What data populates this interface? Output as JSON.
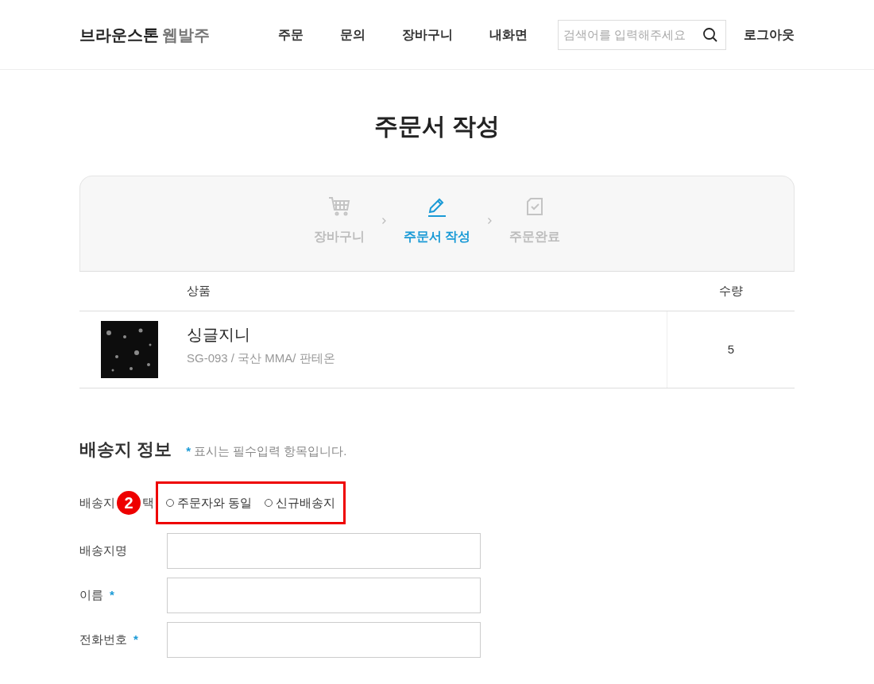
{
  "header": {
    "logo_main": "브라운스톤",
    "logo_sub": "웹발주",
    "nav": [
      {
        "label": "주문"
      },
      {
        "label": "문의"
      },
      {
        "label": "장바구니"
      },
      {
        "label": "내화면"
      }
    ],
    "search": {
      "placeholder": "검색어를 입력해주세요"
    },
    "logout": "로그아웃"
  },
  "page_title": "주문서 작성",
  "steps": [
    {
      "label": "장바구니",
      "selected": false
    },
    {
      "label": "주문서 작성",
      "selected": true
    },
    {
      "label": "주문완료",
      "selected": false
    }
  ],
  "table": {
    "columns": [
      "상품",
      "수량"
    ],
    "rows": [
      {
        "name": "싱글지니",
        "detail": "SG-093 / 국산 MMA/ 판테온",
        "quantity": "5"
      }
    ]
  },
  "shipping": {
    "title": "배송지 정보",
    "required_mark": "*",
    "note": "표시는 필수입력 항목입니다.",
    "choice_label_parts": [
      "배송지",
      "택"
    ],
    "annotation": "2",
    "options": [
      {
        "label": "주문자와 동일",
        "checked": false
      },
      {
        "label": "신규배송지",
        "checked": false
      }
    ],
    "fields": [
      {
        "label": "배송지명",
        "required": false
      },
      {
        "label": "이름",
        "required": true
      },
      {
        "label": "전화번호",
        "required": true
      }
    ]
  }
}
